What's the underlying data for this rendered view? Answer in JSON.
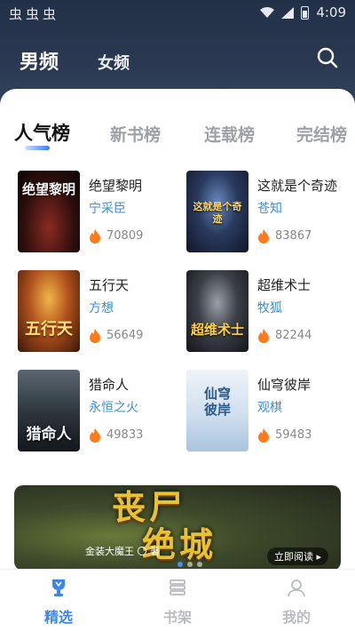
{
  "status_bar": {
    "notifications": "虫虫虫",
    "time": "4:09",
    "icons": [
      "wifi-icon",
      "signal-icon",
      "battery-icon"
    ]
  },
  "header": {
    "tabs": [
      {
        "label": "男频",
        "active": true
      },
      {
        "label": "女频",
        "active": false
      }
    ],
    "search_icon": "search-icon"
  },
  "rank_tabs": [
    {
      "label": "人气榜",
      "active": true
    },
    {
      "label": "新书榜",
      "active": false
    },
    {
      "label": "连载榜",
      "active": false
    },
    {
      "label": "完结榜",
      "active": false
    }
  ],
  "books": [
    {
      "title": "绝望黎明",
      "author": "宁采臣",
      "heat": "70809",
      "cover_text": "绝望黎明"
    },
    {
      "title": "这就是个奇迹",
      "author": "苍知",
      "heat": "83867",
      "cover_text": "这就是个奇迹"
    },
    {
      "title": "五行天",
      "author": "方想",
      "heat": "56649",
      "cover_text": "五行天"
    },
    {
      "title": "超维术士",
      "author": "牧狐",
      "heat": "82244",
      "cover_text": "超维术士"
    },
    {
      "title": "猎命人",
      "author": "永恒之火",
      "heat": "49833",
      "cover_text": "猎命人"
    },
    {
      "title": "仙穹彼岸",
      "author": "观棋",
      "heat": "59483",
      "cover_text": "仙穹彼岸"
    }
  ],
  "banner": {
    "title_line1": "丧尸",
    "title_line2": "绝城",
    "author": "金装大魔王 〇 著",
    "read_label": "立即阅读 ▸",
    "page_count": 3,
    "active_page": 0
  },
  "bottom_nav": [
    {
      "label": "精选",
      "icon": "trophy-icon",
      "active": true
    },
    {
      "label": "书架",
      "icon": "bookshelf-icon",
      "active": false
    },
    {
      "label": "我的",
      "icon": "user-icon",
      "active": false
    }
  ],
  "colors": {
    "accent": "#3b86e8",
    "author": "#3b8fdc",
    "header_bg": "#2b3a52",
    "heat_fire": "#ff7a1a"
  }
}
